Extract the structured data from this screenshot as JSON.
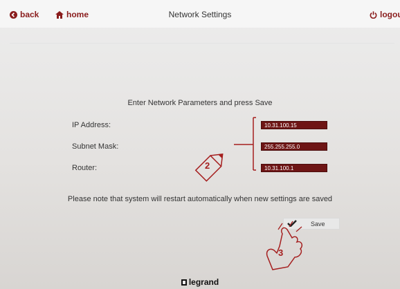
{
  "header": {
    "back_label": "back",
    "home_label": "home",
    "title": "Network Settings",
    "logout_label": "logout"
  },
  "form": {
    "instruction": "Enter Network Parameters and press Save",
    "ip_label": "IP Address:",
    "ip_value": "10.31.100.15",
    "subnet_label": "Subnet Mask:",
    "subnet_value": "255.255.255.0",
    "router_label": "Router:",
    "router_value": "10.31.100.1",
    "note": "Please note that system will restart automatically when new settings are saved",
    "save_label": "Save"
  },
  "annotations": {
    "step_edit": "2",
    "step_save": "3"
  },
  "footer": {
    "brand": "legrand"
  },
  "colors": {
    "accent": "#8a1d1d",
    "field_bg": "#6e1515",
    "annotation": "#a51e1e"
  }
}
